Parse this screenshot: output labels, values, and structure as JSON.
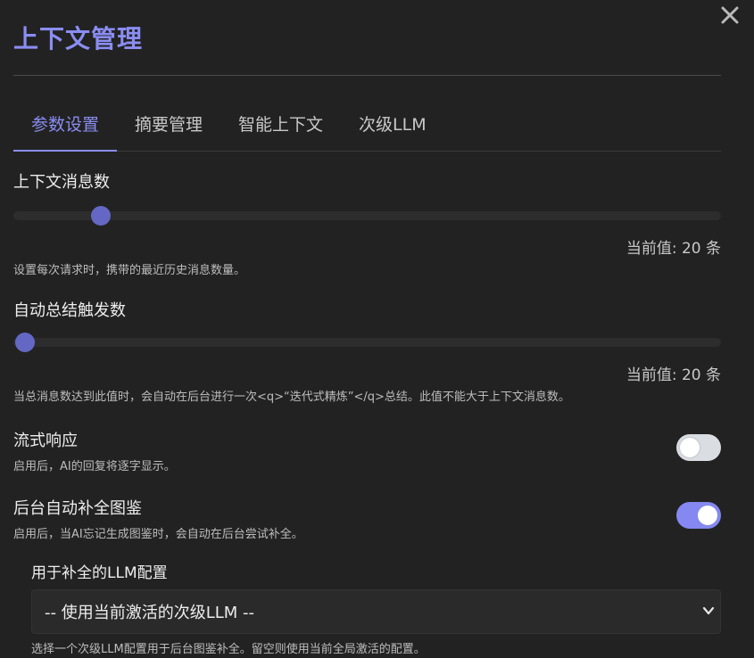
{
  "header": {
    "title": "上下文管理",
    "close_icon": "close-icon"
  },
  "tabs": [
    {
      "label": "参数设置",
      "active": true
    },
    {
      "label": "摘要管理",
      "active": false
    },
    {
      "label": "智能上下文",
      "active": false
    },
    {
      "label": "次级LLM",
      "active": false
    }
  ],
  "context_messages": {
    "label": "上下文消息数",
    "current_value": "当前值: 20 条",
    "slider_fraction": 0.124,
    "hint": "设置每次请求时，携带的最近历史消息数量。"
  },
  "auto_summary": {
    "label": "自动总结触发数",
    "current_value": "当前值: 20 条",
    "slider_fraction": 0.016,
    "hint": "当总消息数达到此值时，会自动在后台进行一次<q>“迭代式精炼”</q>总结。此值不能大于上下文消息数。"
  },
  "streaming": {
    "label": "流式响应",
    "hint": "启用后，AI的回复将逐字显示。",
    "enabled": false
  },
  "auto_complete": {
    "label": "后台自动补全图鉴",
    "hint": "启用后，当AI忘记生成图鉴时，会自动在后台尝试补全。",
    "enabled": true
  },
  "llm_config": {
    "label": "用于补全的LLM配置",
    "selected": "-- 使用当前激活的次级LLM --",
    "hint": "选择一个次级LLM配置用于后台图鉴补全。留空则使用当前全局激活的配置。"
  },
  "colors": {
    "accent": "#8a8df2",
    "slider_thumb": "#6468c4",
    "background": "#222222"
  }
}
